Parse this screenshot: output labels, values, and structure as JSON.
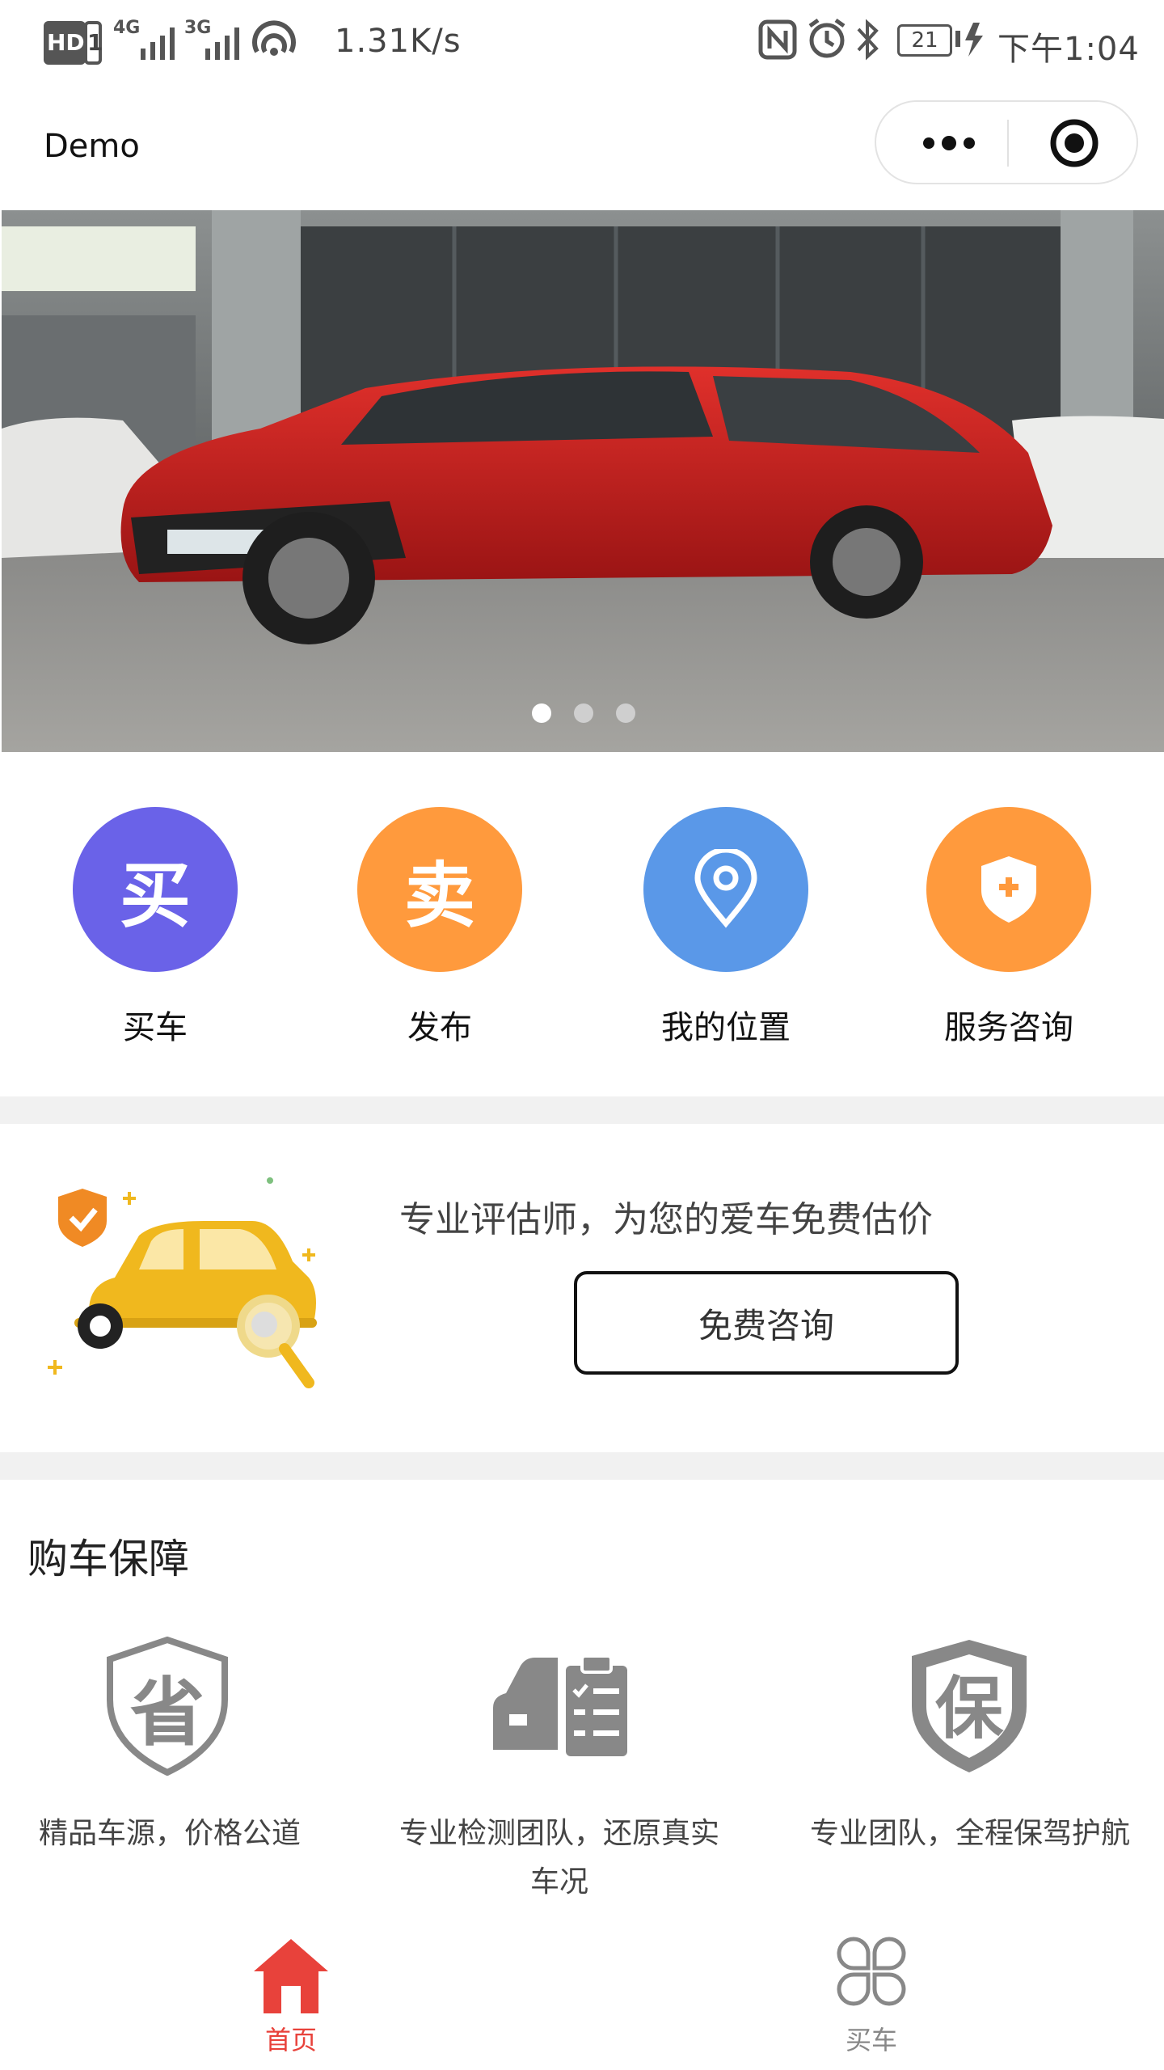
{
  "status_bar": {
    "hd": "HD",
    "sim1": "1",
    "net1": "4G",
    "net2": "3G",
    "speed": "1.31K/s",
    "battery": "21",
    "time": "下午1:04"
  },
  "nav": {
    "title": "Demo"
  },
  "banner": {
    "dot_count": 3,
    "active_dot": 0
  },
  "quick_actions": [
    {
      "icon_char": "买",
      "label": "买车",
      "color": "#6a62e8"
    },
    {
      "icon_char": "卖",
      "label": "发布",
      "color": "#ff9a3d"
    },
    {
      "icon": "location-pin-icon",
      "label": "我的位置",
      "color": "#5a98e8"
    },
    {
      "icon": "shield-plus-icon",
      "label": "服务咨询",
      "color": "#ff9a3d"
    }
  ],
  "promo": {
    "text": "专业评估师，为您的爱车免费估价",
    "button": "免费咨询"
  },
  "guarantee": {
    "title": "购车保障",
    "items": [
      {
        "icon": "shield-sheng-icon",
        "icon_char": "省",
        "text": "精品车源，价格公道"
      },
      {
        "icon": "car-inspection-icon",
        "text": "专业检测团队，还原真实车况"
      },
      {
        "icon": "shield-bao-icon",
        "icon_char": "保",
        "text": "专业团队，全程保驾护航"
      }
    ]
  },
  "tabbar": {
    "items": [
      {
        "label": "首页",
        "icon": "home-icon",
        "active": true
      },
      {
        "label": "买车",
        "icon": "four-petal-icon",
        "active": false
      }
    ],
    "active_color": "#e8423b",
    "inactive_color": "#888888"
  }
}
